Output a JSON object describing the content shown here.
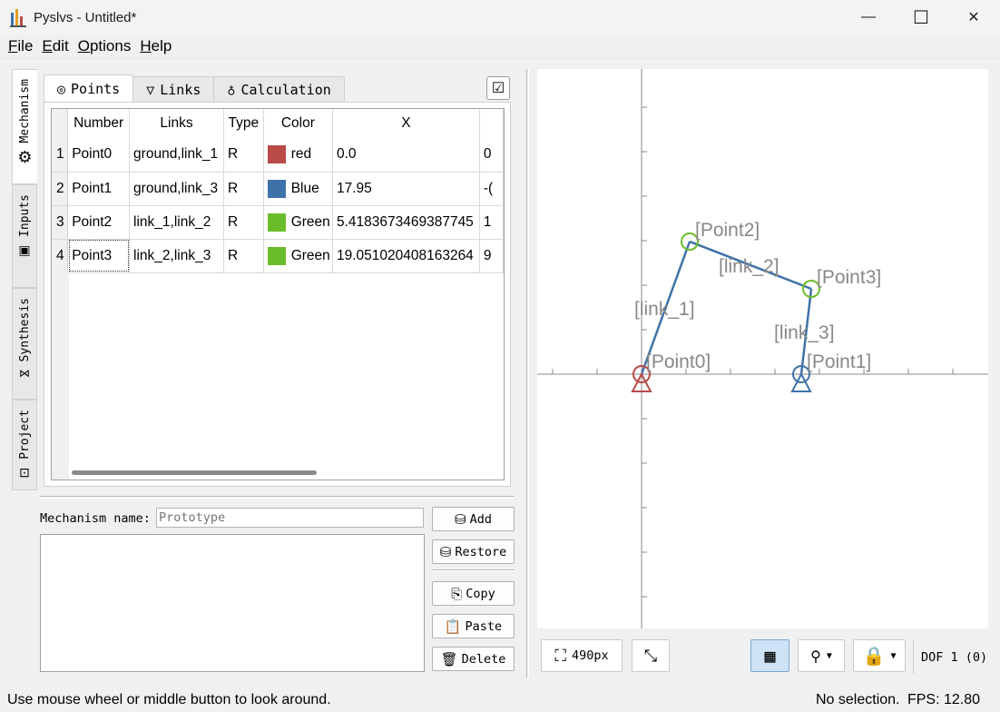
{
  "window": {
    "title": "Pyslvs - Untitled*",
    "minimize": "—",
    "maximize": "☐",
    "close": "✕"
  },
  "menu": [
    {
      "label": "File",
      "key": "F",
      "rest": "ile"
    },
    {
      "label": "Edit",
      "key": "E",
      "rest": "dit"
    },
    {
      "label": "Options",
      "key": "O",
      "rest": "ptions"
    },
    {
      "label": "Help",
      "key": "H",
      "rest": "elp"
    }
  ],
  "side_tabs": [
    {
      "label": "Mechanism",
      "icon": "gear-icon"
    },
    {
      "label": "Inputs",
      "icon": "input-icon"
    },
    {
      "label": "Synthesis",
      "icon": "synthesis-icon"
    },
    {
      "label": "Project",
      "icon": "project-icon"
    }
  ],
  "tabs": [
    {
      "label": "Points",
      "icon": "points-icon"
    },
    {
      "label": "Links",
      "icon": "links-icon"
    },
    {
      "label": "Calculation",
      "icon": "calculation-icon"
    }
  ],
  "table": {
    "headers": [
      "Number",
      "Links",
      "Type",
      "Color",
      "X",
      ""
    ],
    "rows": [
      {
        "n": "1",
        "number": "Point0",
        "links": "ground,link_1",
        "type": "R",
        "color": "red",
        "color_hex": "#b94a48",
        "x": "0.0",
        "y": "0"
      },
      {
        "n": "2",
        "number": "Point1",
        "links": "ground,link_3",
        "type": "R",
        "color": "Blue",
        "color_hex": "#3f72a8",
        "x": "17.95",
        "y": "-("
      },
      {
        "n": "3",
        "number": "Point2",
        "links": "link_1,link_2",
        "type": "R",
        "color": "Green",
        "color_hex": "#6cbd2c",
        "x": "5.4183673469387745",
        "y": "1"
      },
      {
        "n": "4",
        "number": "Point3",
        "links": "link_2,link_3",
        "type": "R",
        "color": "Green",
        "color_hex": "#6cbd2c",
        "x": "19.051020408163264",
        "y": "9"
      }
    ]
  },
  "mechanism_name": {
    "label": "Mechanism name:",
    "placeholder": "Prototype"
  },
  "buttons": {
    "add": "Add",
    "restore": "Restore",
    "copy": "Copy",
    "paste": "Paste",
    "delete": "Delete"
  },
  "canvas": {
    "points": [
      "[Point0]",
      "[Point1]",
      "[Point2]",
      "[Point3]"
    ],
    "links": [
      "[link_1]",
      "[link_2]",
      "[link_3]"
    ]
  },
  "toolbar": {
    "zoom": "490px",
    "dof": "DOF 1  (0)"
  },
  "status": {
    "left": "Use mouse wheel or middle button to look around.",
    "selection": "No selection.",
    "fps": "FPS:  12.80"
  }
}
